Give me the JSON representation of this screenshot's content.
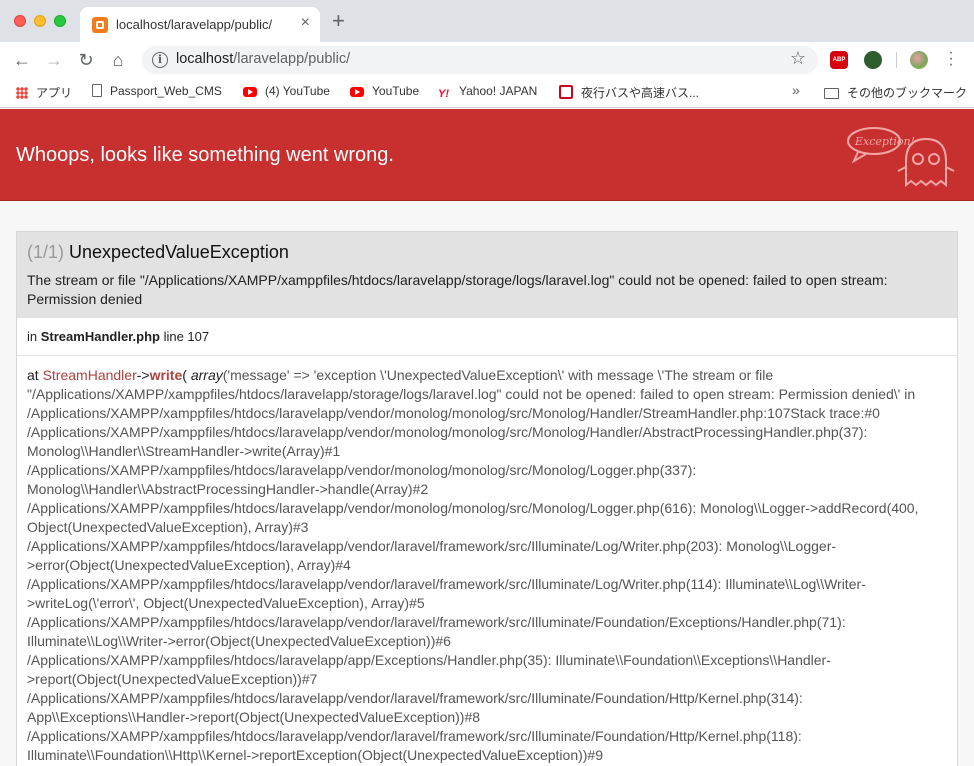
{
  "browser": {
    "tab_title": "localhost/laravelapp/public/",
    "url_host": "localhost",
    "url_path": "/laravelapp/public/",
    "abp_label": "ABP",
    "bookmarks": [
      {
        "label": "アプリ",
        "icon": "apps-icon"
      },
      {
        "label": "Passport_Web_CMS",
        "icon": "page-icon"
      },
      {
        "label": "(4) YouTube",
        "icon": "youtube-icon"
      },
      {
        "label": "YouTube",
        "icon": "youtube-icon"
      },
      {
        "label": "Yahoo! JAPAN",
        "icon": "yahoo-icon"
      },
      {
        "label": "夜行バスや高速バス...",
        "icon": "bus-icon"
      }
    ],
    "other_bookmarks": "その他のブックマーク"
  },
  "error_page": {
    "header_title": "Whoops, looks like something went wrong.",
    "header_color": "#c7302f",
    "exception_count": "(1/1)",
    "exception_class": "UnexpectedValueException",
    "exception_message": "The stream or file \"/Applications/XAMPP/xamppfiles/htdocs/laravelapp/storage/logs/laravel.log\" could not be opened: failed to open stream: Permission denied",
    "location_prefix": "in",
    "location_file": "StreamHandler.php",
    "location_line": "line 107",
    "trace": {
      "at": "at",
      "class": "StreamHandler",
      "arrow": "->",
      "method": "write",
      "open": "(",
      "arg_type": "array",
      "args": "('message' => 'exception \\'UnexpectedValueException\\' with message \\'The stream or file \"/Applications/XAMPP/xamppfiles/htdocs/laravelapp/storage/logs/laravel.log\" could not be opened: failed to open stream: Permission denied\\' in /Applications/XAMPP/xamppfiles/htdocs/laravelapp/vendor/monolog/monolog/src/Monolog/Handler/StreamHandler.php:107Stack trace:#0 /Applications/XAMPP/xamppfiles/htdocs/laravelapp/vendor/monolog/monolog/src/Monolog/Handler/AbstractProcessingHandler.php(37): Monolog\\\\Handler\\\\StreamHandler->write(Array)#1 /Applications/XAMPP/xamppfiles/htdocs/laravelapp/vendor/monolog/monolog/src/Monolog/Logger.php(337): Monolog\\\\Handler\\\\AbstractProcessingHandler->handle(Array)#2 /Applications/XAMPP/xamppfiles/htdocs/laravelapp/vendor/monolog/monolog/src/Monolog/Logger.php(616): Monolog\\\\Logger->addRecord(400, Object(UnexpectedValueException), Array)#3 /Applications/XAMPP/xamppfiles/htdocs/laravelapp/vendor/laravel/framework/src/Illuminate/Log/Writer.php(203): Monolog\\\\Logger->error(Object(UnexpectedValueException), Array)#4 /Applications/XAMPP/xamppfiles/htdocs/laravelapp/vendor/laravel/framework/src/Illuminate/Log/Writer.php(114): Illuminate\\\\Log\\\\Writer->writeLog(\\'error\\', Object(UnexpectedValueException), Array)#5 /Applications/XAMPP/xamppfiles/htdocs/laravelapp/vendor/laravel/framework/src/Illuminate/Foundation/Exceptions/Handler.php(71): Illuminate\\\\Log\\\\Writer->error(Object(UnexpectedValueException))#6 /Applications/XAMPP/xamppfiles/htdocs/laravelapp/app/Exceptions/Handler.php(35): Illuminate\\\\Foundation\\\\Exceptions\\\\Handler->report(Object(UnexpectedValueException))#7 /Applications/XAMPP/xamppfiles/htdocs/laravelapp/vendor/laravel/framework/src/Illuminate/Foundation/Http/Kernel.php(314): App\\\\Exceptions\\\\Handler->report(Object(UnexpectedValueException))#8 /Applications/XAMPP/xamppfiles/htdocs/laravelapp/vendor/laravel/framework/src/Illuminate/Foundation/Http/Kernel.php(118): Illuminate\\\\Foundation\\\\Http\\\\Kernel->reportException(Object(UnexpectedValueException))#9"
    }
  }
}
